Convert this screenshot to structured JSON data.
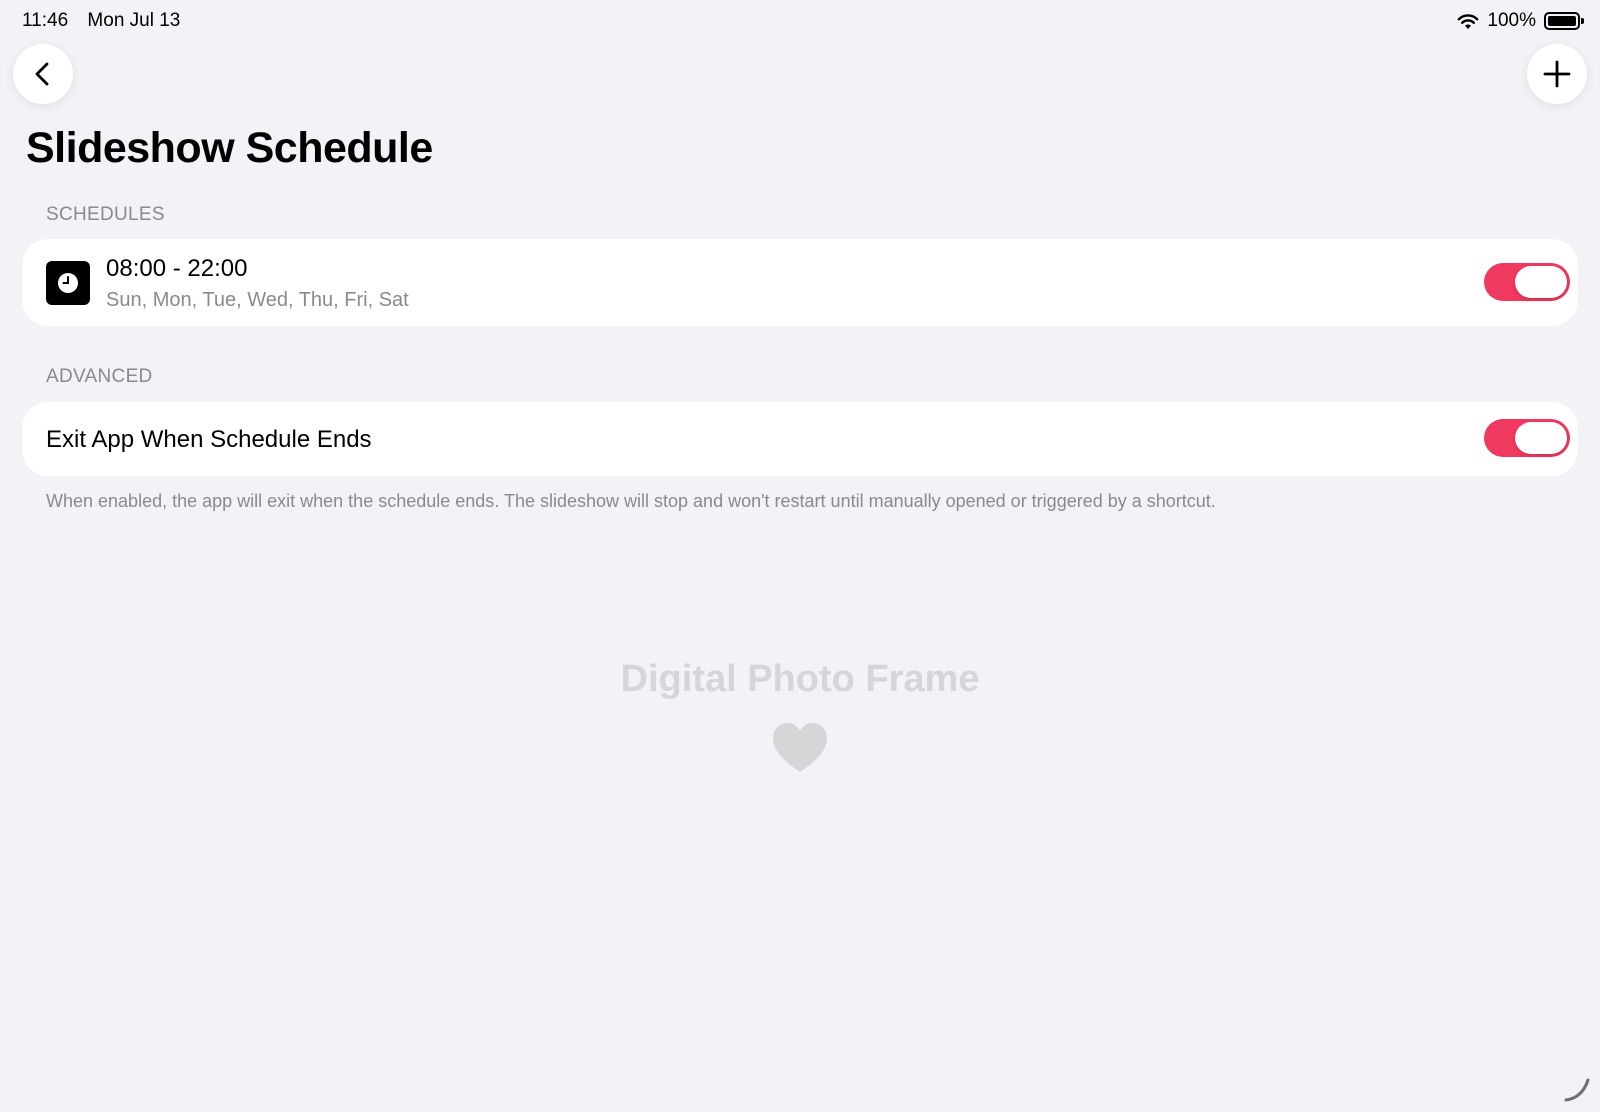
{
  "status_bar": {
    "time": "11:46",
    "date": "Mon Jul 13",
    "battery_text": "100%",
    "wifi_icon": "wifi-icon",
    "battery_icon": "battery-full-icon"
  },
  "nav": {
    "back_icon": "chevron-left-icon",
    "add_icon": "plus-icon"
  },
  "page": {
    "title": "Slideshow Schedule"
  },
  "schedules": {
    "header": "SCHEDULES",
    "items": [
      {
        "time_range": "08:00 - 22:00",
        "days": "Sun, Mon, Tue, Wed, Thu, Fri, Sat",
        "icon": "clock-icon",
        "enabled": true
      }
    ]
  },
  "advanced": {
    "header": "ADVANCED",
    "exit_label": "Exit App When Schedule Ends",
    "exit_enabled": true,
    "footnote": "When enabled, the app will exit when the schedule ends. The slideshow will stop and won't restart until manually opened or triggered by a shortcut."
  },
  "branding": {
    "app_name": "Digital Photo Frame",
    "icon": "heart-icon"
  },
  "colors": {
    "background": "#f2f2f7",
    "toggle_on": "#f0395f",
    "secondary_text": "#8a8a8e",
    "brand_text": "#d6d6d9"
  }
}
